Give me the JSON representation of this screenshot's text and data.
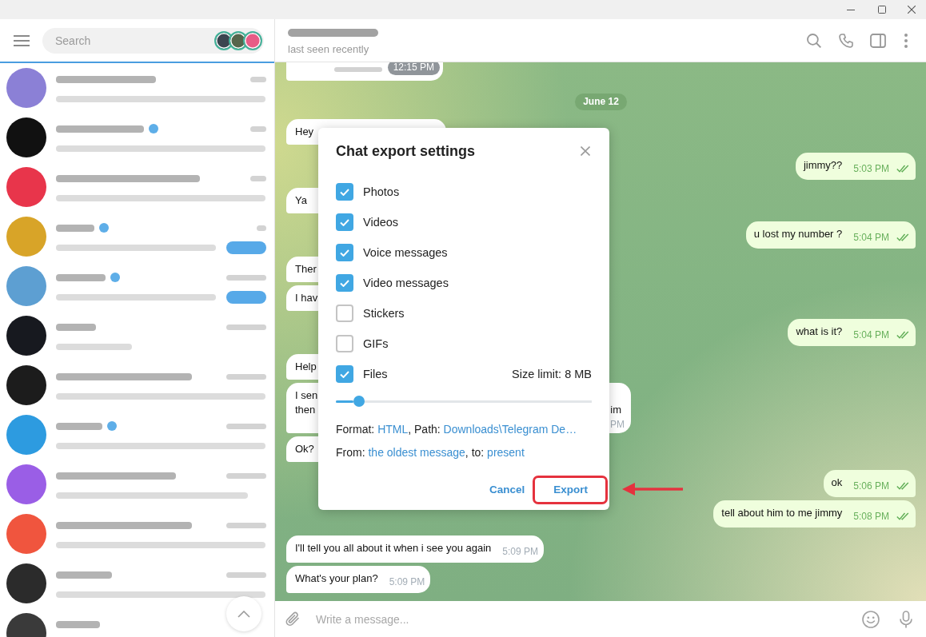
{
  "sidebar": {
    "search": {
      "placeholder": "Search"
    },
    "stories": [
      {
        "color": "#3b4650"
      },
      {
        "color": "#56654c"
      },
      {
        "color": "#e85c86"
      }
    ],
    "chats": [
      {
        "color": "#8b80d6",
        "verified": false,
        "pill": false
      },
      {
        "color": "#111111",
        "verified": true,
        "pill": false
      },
      {
        "color": "#e8354b",
        "verified": false,
        "pill": false
      },
      {
        "color": "#d8a428",
        "verified": true,
        "pill": true
      },
      {
        "color": "#5d9fd2",
        "verified": true,
        "pill": true
      },
      {
        "color": "#17191f",
        "verified": false,
        "pill": false
      },
      {
        "color": "#1c1c1c",
        "verified": false,
        "pill": false
      },
      {
        "color": "#2d9be0",
        "verified": true,
        "pill": false
      },
      {
        "color": "#9a5ee6",
        "verified": false,
        "pill": false
      },
      {
        "color": "#f0553e",
        "verified": false,
        "pill": false
      },
      {
        "color": "#2b2b2b",
        "verified": false,
        "pill": false
      },
      {
        "color": "#3a3a3a",
        "verified": false,
        "pill": false
      }
    ]
  },
  "chat": {
    "header": {
      "status": "last seen recently"
    },
    "messages": [
      {
        "kind": "card",
        "outgoing": false,
        "time": "12:15 PM"
      },
      {
        "kind": "date",
        "text": "June 12"
      },
      {
        "kind": "partial",
        "outgoing": false,
        "text": "Hey"
      },
      {
        "kind": "text",
        "outgoing": true,
        "text": "jimmy??",
        "time": "5:03 PM",
        "read": true
      },
      {
        "kind": "partial",
        "outgoing": false,
        "text": "Ya"
      },
      {
        "kind": "text",
        "outgoing": true,
        "text": "u lost my number ?",
        "time": "5:04 PM",
        "read": true
      },
      {
        "kind": "partial",
        "outgoing": false,
        "text": "Ther"
      },
      {
        "kind": "partial",
        "outgoing": false,
        "text": "I hav"
      },
      {
        "kind": "text",
        "outgoing": true,
        "text": "what is it?",
        "time": "5:04 PM",
        "read": true
      },
      {
        "kind": "partial",
        "outgoing": false,
        "text": "Help"
      },
      {
        "kind": "split",
        "outgoing": false,
        "text": "I sen\nthen",
        "tail_text": "im",
        "tail_time": "PM"
      },
      {
        "kind": "partial",
        "outgoing": false,
        "text": "Ok?"
      },
      {
        "kind": "text",
        "outgoing": true,
        "text": "ok",
        "time": "5:06 PM",
        "read": true
      },
      {
        "kind": "text",
        "outgoing": true,
        "text": "tell about him to me jimmy",
        "time": "5:08 PM",
        "read": true
      },
      {
        "kind": "text",
        "outgoing": false,
        "text": "I'll tell you all about it when i see you again",
        "time": "5:09 PM"
      },
      {
        "kind": "text",
        "outgoing": false,
        "text": "What's your plan?",
        "time": "5:09 PM"
      }
    ],
    "composer": {
      "placeholder": "Write a message..."
    }
  },
  "dialog": {
    "title": "Chat export settings",
    "options": [
      {
        "label": "Photos",
        "checked": true
      },
      {
        "label": "Videos",
        "checked": true
      },
      {
        "label": "Voice messages",
        "checked": true
      },
      {
        "label": "Video messages",
        "checked": true
      },
      {
        "label": "Stickers",
        "checked": false
      },
      {
        "label": "GIFs",
        "checked": false
      },
      {
        "label": "Files",
        "checked": true,
        "note": "Size limit: 8 MB"
      }
    ],
    "size_limit": {
      "level": 0.09
    },
    "lines": [
      [
        {
          "kind": "text",
          "text": "Format: "
        },
        {
          "kind": "link",
          "text": "HTML"
        },
        {
          "kind": "text",
          "text": ", Path: "
        },
        {
          "kind": "link",
          "text": "Downloads\\Telegram De…"
        }
      ],
      [
        {
          "kind": "text",
          "text": "From: "
        },
        {
          "kind": "link",
          "text": "the oldest message"
        },
        {
          "kind": "text",
          "text": ", to: "
        },
        {
          "kind": "link",
          "text": "present"
        }
      ]
    ],
    "buttons": [
      {
        "label": "Cancel",
        "highlighted": false
      },
      {
        "label": "Export",
        "highlighted": true
      }
    ]
  }
}
